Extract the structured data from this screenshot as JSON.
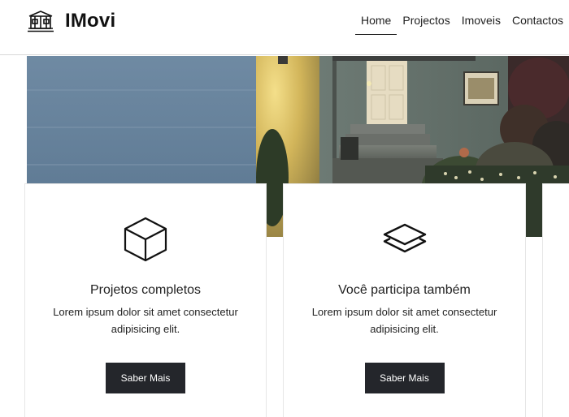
{
  "brand": {
    "name": "IMovi",
    "icon": "house-icon"
  },
  "nav": {
    "items": [
      {
        "label": "Home",
        "active": true
      },
      {
        "label": "Projectos",
        "active": false
      },
      {
        "label": "Imoveis",
        "active": false
      },
      {
        "label": "Contactos",
        "active": false
      }
    ]
  },
  "cards": [
    {
      "icon": "box-icon",
      "title": "Projetos completos",
      "text": "Lorem ipsum dolor sit amet consectetur adipisicing elit.",
      "button": "Saber Mais"
    },
    {
      "icon": "layers-icon",
      "title": "Você participa também",
      "text": "Lorem ipsum dolor sit amet consectetur adipisicing elit.",
      "button": "Saber Mais"
    }
  ]
}
